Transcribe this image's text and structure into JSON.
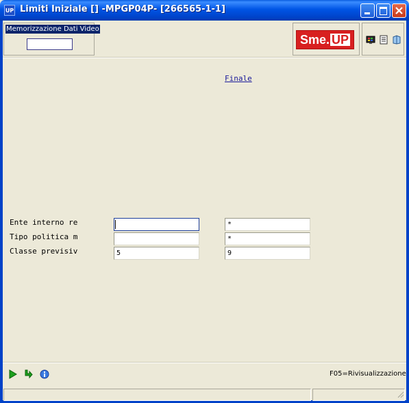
{
  "window": {
    "app_icon": "UP",
    "title": "Limiti Iniziale [] -MPGP04P- [266565-1-1]"
  },
  "header": {
    "memorizzazione_label": "Memorizzazione Dati Video",
    "memorizzazione_value": "",
    "logo_text": "Sme.",
    "logo_up": "UP",
    "toolbar_icons": [
      "display-settings-icon",
      "notepad-icon",
      "help-book-icon"
    ]
  },
  "main": {
    "finale_label": "Finale",
    "rows": [
      {
        "label": "Ente interno re",
        "from": "",
        "to": "*"
      },
      {
        "label": "Tipo politica m",
        "from": "",
        "to": "*"
      },
      {
        "label": "Classe previsiv",
        "from": "5",
        "to": "9"
      }
    ]
  },
  "footer": {
    "icons": [
      "run-play-icon",
      "refresh-arrow-icon",
      "info-icon"
    ],
    "fkey_hint": "F05=Rivisualizzazione"
  },
  "colors": {
    "titlebar": "#0055E5",
    "background": "#ECE9D8",
    "logo_red": "#D82020",
    "finale_link": "#1A1A9A"
  }
}
